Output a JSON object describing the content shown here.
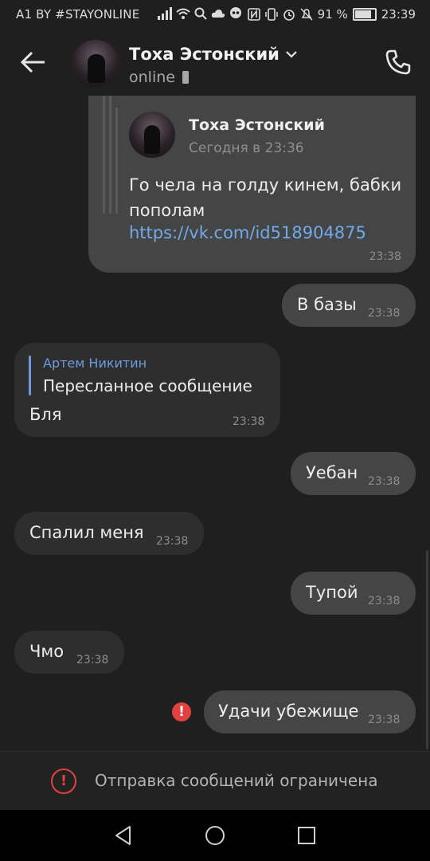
{
  "status_bar": {
    "carrier": "A1 BY #STAYONLINE",
    "battery": "91 %",
    "time": "23:39"
  },
  "header": {
    "name": "Тоха Эстонский",
    "status": "online"
  },
  "forwarded_card": {
    "author": "Тоха Эстонский",
    "date": "Сегодня в 23:36",
    "text": "Го чела на голду кинем, бабки пополам",
    "link": "https://vk.com/id518904875",
    "time": "23:38"
  },
  "messages": [
    {
      "text": "В базы",
      "time": "23:38"
    },
    {
      "reply_author": "Артем Никитин",
      "reply_text": "Пересланное сообщение",
      "text": "Бля",
      "time": "23:38"
    },
    {
      "text": "Уебан",
      "time": "23:38"
    },
    {
      "text": "Спалил меня",
      "time": "23:38"
    },
    {
      "text": "Тупой",
      "time": "23:38"
    },
    {
      "text": "Чмо",
      "time": "23:38"
    },
    {
      "text": "Удачи убежище",
      "time": "23:38"
    }
  ],
  "error_mark": "!",
  "restricted": {
    "text": "Отправка сообщений ограничена"
  },
  "colors": {
    "accent_link": "#71aaeb",
    "reply_name": "#6e9be0",
    "error": "#e1423f"
  }
}
